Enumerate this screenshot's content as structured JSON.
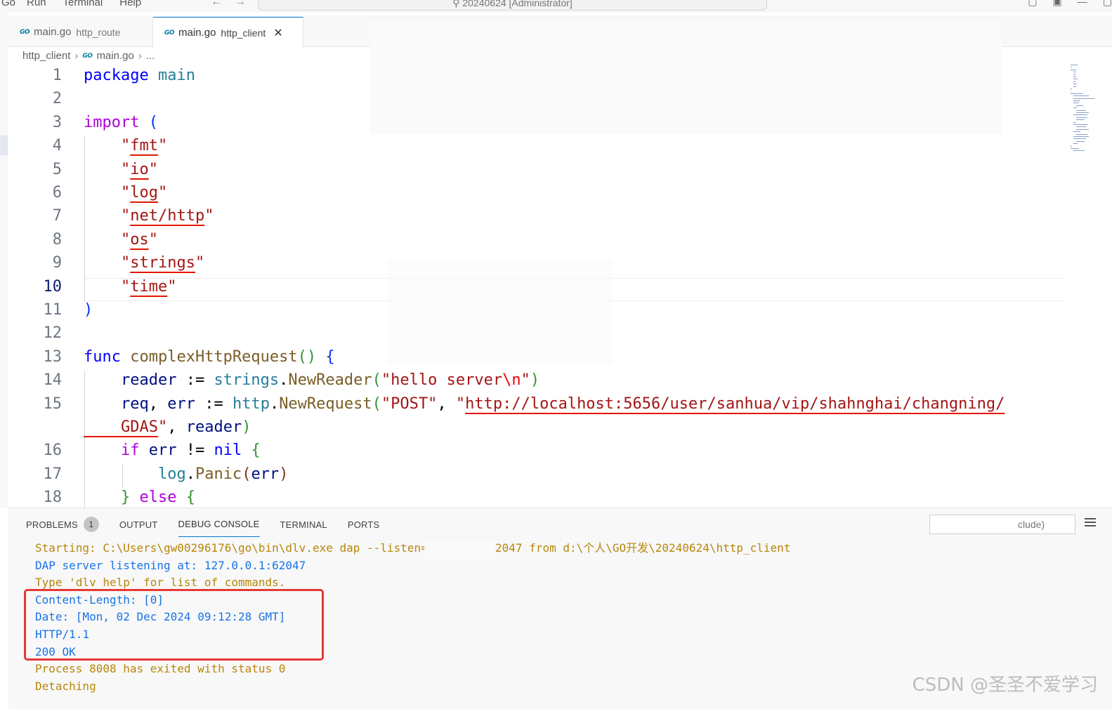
{
  "menu": [
    "Go",
    "Run",
    "Terminal",
    "Help"
  ],
  "command_center": "20240624 [Administrator]",
  "tabs": [
    {
      "file": "main.go",
      "desc": "http_route"
    },
    {
      "file": "main.go",
      "desc": "http_client"
    }
  ],
  "go_label": "GO",
  "breadcrumb": {
    "folder": "http_client",
    "file": "main.go",
    "more": "..."
  },
  "editor": {
    "line_numbers": [
      "1",
      "2",
      "3",
      "4",
      "5",
      "6",
      "7",
      "8",
      "9",
      "10",
      "11",
      "12",
      "13",
      "14",
      "15",
      "",
      "16",
      "17",
      "18"
    ],
    "lines": [
      {
        "t": [
          [
            "kw",
            "package"
          ],
          [
            "",
            "main",
            1
          ]
        ]
      },
      {
        "t": []
      },
      {
        "t": [
          [
            "ctl",
            "import"
          ],
          [
            "b1",
            " ("
          ]
        ]
      },
      {
        "t": [
          [
            "str",
            "    \""
          ],
          [
            "str sq",
            "fmt"
          ],
          [
            "str",
            "\""
          ]
        ]
      },
      {
        "t": [
          [
            "str",
            "    \""
          ],
          [
            "str sq",
            "io"
          ],
          [
            "str",
            "\""
          ]
        ]
      },
      {
        "t": [
          [
            "str",
            "    \""
          ],
          [
            "str sq",
            "log"
          ],
          [
            "str",
            "\""
          ]
        ]
      },
      {
        "t": [
          [
            "str",
            "    \""
          ],
          [
            "str sq",
            "net/http"
          ],
          [
            "str",
            "\""
          ]
        ]
      },
      {
        "t": [
          [
            "str",
            "    \""
          ],
          [
            "str sq",
            "os"
          ],
          [
            "str",
            "\""
          ]
        ]
      },
      {
        "t": [
          [
            "str",
            "    \""
          ],
          [
            "str sq",
            "strings"
          ],
          [
            "str",
            "\""
          ]
        ]
      },
      {
        "t": [
          [
            "str",
            "    \""
          ],
          [
            "str sq",
            "time"
          ],
          [
            "str",
            "\""
          ]
        ]
      },
      {
        "t": [
          [
            "b1",
            ")"
          ]
        ]
      },
      {
        "t": []
      },
      {
        "t": [
          [
            "kw",
            "func "
          ],
          [
            "fn",
            "complexHttpRequest"
          ],
          [
            "b2",
            "()"
          ],
          [
            "",
            ""
          ],
          [
            "b1",
            " {"
          ]
        ]
      },
      {
        "t": [
          [
            "id",
            "    reader "
          ],
          [
            "",
            ":= "
          ],
          [
            "pkgname",
            "strings"
          ],
          [
            "",
            "."
          ],
          [
            "fn",
            "NewReader"
          ],
          [
            "b2",
            "("
          ],
          [
            "str",
            "\"hello server"
          ],
          [
            "esc",
            "\\n"
          ],
          [
            "str",
            "\""
          ],
          [
            "b2",
            ")"
          ]
        ]
      },
      {
        "t": [
          [
            "id",
            "    req"
          ],
          [
            "",
            ", "
          ],
          [
            "id",
            "err"
          ],
          [
            "",
            " := "
          ],
          [
            "pkgname",
            "http"
          ],
          [
            "",
            "."
          ],
          [
            "fn",
            "NewRequest"
          ],
          [
            "b2",
            "("
          ],
          [
            "str",
            "\"POST\""
          ],
          [
            "",
            ", "
          ],
          [
            "str",
            "\""
          ],
          [
            "str sq",
            "http://localhost:5656/user/sanhua/vip/shahnghai/changning/"
          ]
        ]
      },
      {
        "t": [
          [
            "str sq",
            "    GDAS"
          ],
          [
            "str",
            "\""
          ],
          [
            "",
            ", "
          ],
          [
            "id",
            "reader"
          ],
          [
            "b2",
            ")"
          ]
        ]
      },
      {
        "t": [
          [
            "ctl",
            "    if "
          ],
          [
            "id",
            "err"
          ],
          [
            "",
            " != "
          ],
          [
            "kw",
            "nil"
          ],
          [
            "b2",
            " {"
          ]
        ]
      },
      {
        "t": [
          [
            "pkgname",
            "        log"
          ],
          [
            "",
            "."
          ],
          [
            "fn",
            "Panic"
          ],
          [
            "b3",
            "("
          ],
          [
            "id",
            "err"
          ],
          [
            "b3",
            ")"
          ]
        ]
      },
      {
        "t": [
          [
            "b2",
            "    }"
          ],
          [
            "ctl",
            " else"
          ],
          [
            "b2",
            " {"
          ]
        ]
      }
    ]
  },
  "panel": {
    "tabs": [
      "PROBLEMS",
      "OUTPUT",
      "DEBUG CONSOLE",
      "TERMINAL",
      "PORTS"
    ],
    "problems_count": "1",
    "filter_placeholder": "clude)",
    "console": [
      {
        "c": "orange",
        "text": "Starting: C:\\Users\\gw00296176\\go\\bin\\dlv.exe dap --listen=          2047 from d:\\个人\\GO开发\\20240624\\http_client"
      },
      {
        "c": "blue",
        "text": "DAP server listening at: 127.0.0.1:62047"
      },
      {
        "c": "orange",
        "text": "Type 'dlv help' for list of commands."
      },
      {
        "c": "blue",
        "text": "Content-Length: [0]"
      },
      {
        "c": "blue",
        "text": "Date: [Mon, 02 Dec 2024 09:12:28 GMT]"
      },
      {
        "c": "blue",
        "text": "HTTP/1.1"
      },
      {
        "c": "blue",
        "text": "200 OK"
      },
      {
        "c": "orange",
        "text": "Process 8008 has exited with status 0"
      },
      {
        "c": "orange",
        "text": "Detaching"
      }
    ]
  },
  "watermark": "CSDN @圣圣不爱学习"
}
